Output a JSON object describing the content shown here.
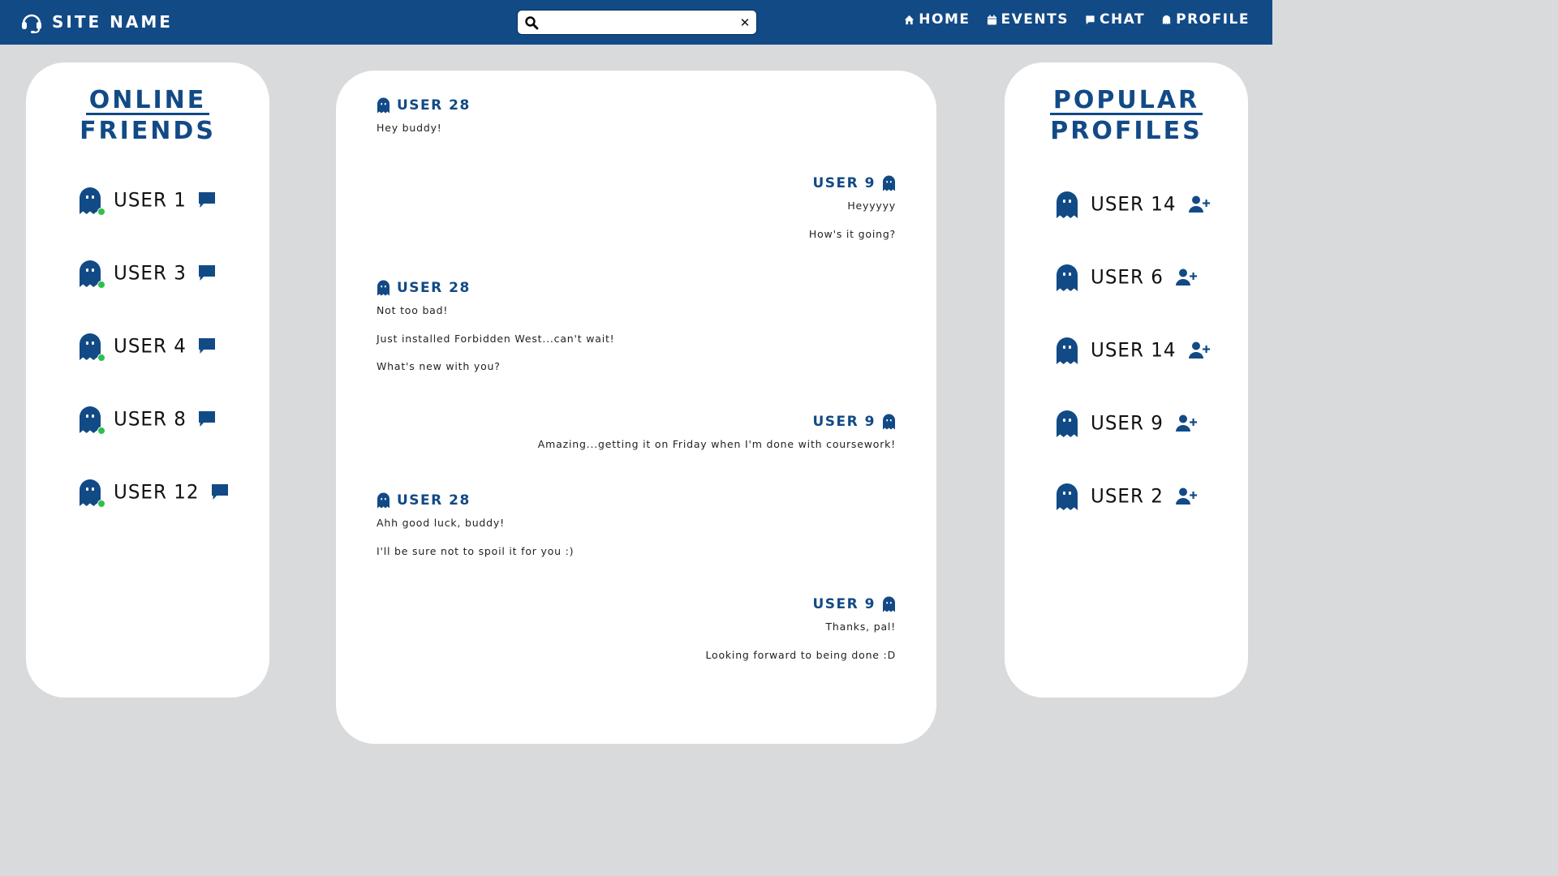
{
  "header": {
    "site_name": "SITE NAME",
    "search": {
      "value": "",
      "placeholder": ""
    },
    "nav": [
      {
        "label": "HOME",
        "icon": "home-icon"
      },
      {
        "label": "EVENTS",
        "icon": "calendar-icon"
      },
      {
        "label": "CHAT",
        "icon": "chat-bubble-icon"
      },
      {
        "label": "PROFILE",
        "icon": "ghost-icon"
      }
    ]
  },
  "online_friends": {
    "title_line1": "ONLINE",
    "title_line2": "FRIENDS",
    "users": [
      {
        "name": "USER 1",
        "status": "online"
      },
      {
        "name": "USER 3",
        "status": "online"
      },
      {
        "name": "USER 4",
        "status": "online"
      },
      {
        "name": "USER 8",
        "status": "online"
      },
      {
        "name": "USER 12",
        "status": "online"
      }
    ]
  },
  "popular_profiles": {
    "title_line1": "POPULAR",
    "title_line2": "PROFILES",
    "users": [
      {
        "name": "USER 14"
      },
      {
        "name": "USER 6"
      },
      {
        "name": "USER 14"
      },
      {
        "name": "USER 9"
      },
      {
        "name": "USER 2"
      }
    ]
  },
  "chat": {
    "messages": [
      {
        "author": "USER 28",
        "side": "left",
        "lines": [
          "Hey buddy!"
        ]
      },
      {
        "author": "USER 9",
        "side": "right",
        "lines": [
          "Heyyyyy",
          "How's it going?"
        ]
      },
      {
        "author": "USER 28",
        "side": "left",
        "lines": [
          "Not too bad!",
          "Just installed Forbidden West...can't wait!",
          "What's new with you?"
        ]
      },
      {
        "author": "USER 9",
        "side": "right",
        "lines": [
          "Amazing...getting it on Friday when I'm done with coursework!"
        ]
      },
      {
        "author": "USER 28",
        "side": "left",
        "lines": [
          "Ahh good luck, buddy!",
          "I'll be sure not to spoil it for you :)"
        ]
      },
      {
        "author": "USER 9",
        "side": "right",
        "lines": [
          "Thanks, pal!",
          "Looking forward to being done :D"
        ]
      }
    ]
  },
  "colors": {
    "primary": "#124a86",
    "background": "#d9dadc",
    "online": "#2ec04d"
  }
}
